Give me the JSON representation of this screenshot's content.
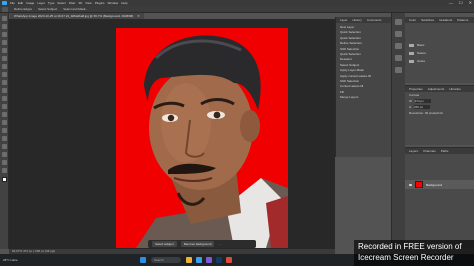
{
  "menubar": {
    "items": [
      "File",
      "Edit",
      "Image",
      "Layer",
      "Type",
      "Select",
      "Filter",
      "3D",
      "View",
      "Plugins",
      "Window",
      "Help"
    ],
    "window_controls": [
      "—",
      "☐",
      "✕"
    ]
  },
  "optionsbar": {
    "items": [
      "Refine Edges",
      "Select Subject",
      "Select and Mask..."
    ]
  },
  "document": {
    "tab_title": "WhatsApp Image 2023-10-25 at 16.07.24_9d6a2ba8.jpg @ 66.7% (Background, RGB/8#)",
    "close_glyph": "✕"
  },
  "context_bar": {
    "select_subject": "Select subject",
    "remove_background": "Remove background",
    "more_glyph": "···"
  },
  "statusbar": {
    "text": "66.67%   474 px x 266 px (96 ppi)"
  },
  "history_panel": {
    "tabs": [
      "Layer",
      "History",
      "Comments"
    ],
    "items": [
      "New Layer",
      "Quick Selection",
      "Quick Selection",
      "Refine Selection",
      "Shift Selection",
      "Quick Selection",
      "Deselect",
      "Select Subject",
      "Apply Layer Mask",
      "Apply content-aware fill",
      "Shift Selection",
      "Content aware fill",
      "Fill",
      "Merge Layers"
    ]
  },
  "libraries_panel": {
    "tabs": [
      "Color",
      "Swatches",
      "Gradients",
      "Patterns"
    ],
    "folders": [
      "Basic",
      "Nature",
      "Grass"
    ]
  },
  "properties_panel": {
    "tabs": [
      "Properties",
      "Adjustments",
      "Libraries"
    ],
    "section": "Canvas",
    "width_label": "W",
    "width_value": "474 px",
    "height_label": "H",
    "height_value": "266 px",
    "resolution": "Resolution: 96 pixels/inch"
  },
  "layers_panel": {
    "tabs": [
      "Layers",
      "Channels",
      "Paths"
    ],
    "layer_name": "Background"
  },
  "taskbar": {
    "weather": "28°C Haze",
    "search_placeholder": "Search"
  },
  "watermark": {
    "line1": "Recorded in FREE version of",
    "line2": "Icecream Screen Recorder"
  },
  "colors": {
    "photo_background": "#f00000",
    "workspace_dark": "#282828",
    "panel": "#4a4a4a",
    "accent": "#31a8ff"
  }
}
